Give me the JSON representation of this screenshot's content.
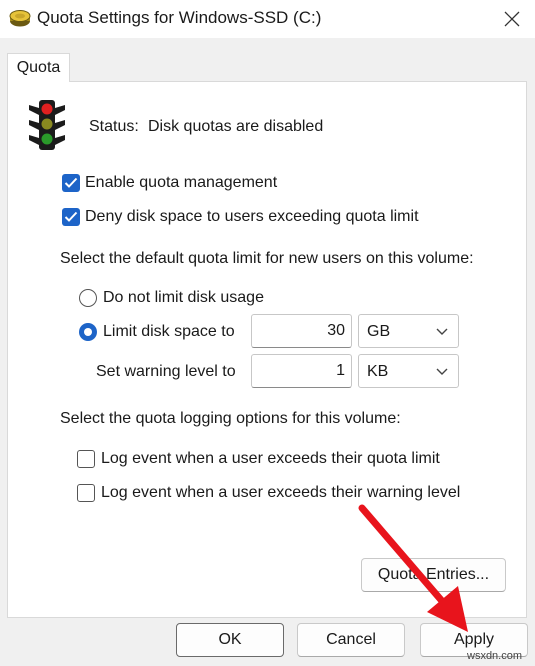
{
  "window": {
    "title": "Quota Settings for Windows-SSD (C:)"
  },
  "tabs": [
    {
      "label": "Quota"
    }
  ],
  "status": {
    "label": "Status:",
    "value": "Disk quotas are disabled"
  },
  "options": {
    "enable_quota": {
      "label": "Enable quota management",
      "checked": true
    },
    "deny_space": {
      "label": "Deny disk space to users exceeding quota limit",
      "checked": true
    }
  },
  "default_limit": {
    "heading": "Select the default quota limit for new users on this volume:",
    "no_limit_label": "Do not limit disk usage",
    "limit_label": "Limit disk space to",
    "limit_value": "30",
    "limit_unit": "GB",
    "warning_label": "Set warning level to",
    "warning_value": "1",
    "warning_unit": "KB",
    "selected": "limit"
  },
  "logging": {
    "heading": "Select the quota logging options for this volume:",
    "log_limit_label": "Log event when a user exceeds their quota limit",
    "log_warning_label": "Log event when a user exceeds their warning level"
  },
  "buttons": {
    "quota_entries": "Quota Entries...",
    "ok": "OK",
    "cancel": "Cancel",
    "apply": "Apply"
  },
  "watermark": "wsxdn.com",
  "colors": {
    "accent": "#1d64c8",
    "arrow": "#e8141c"
  }
}
